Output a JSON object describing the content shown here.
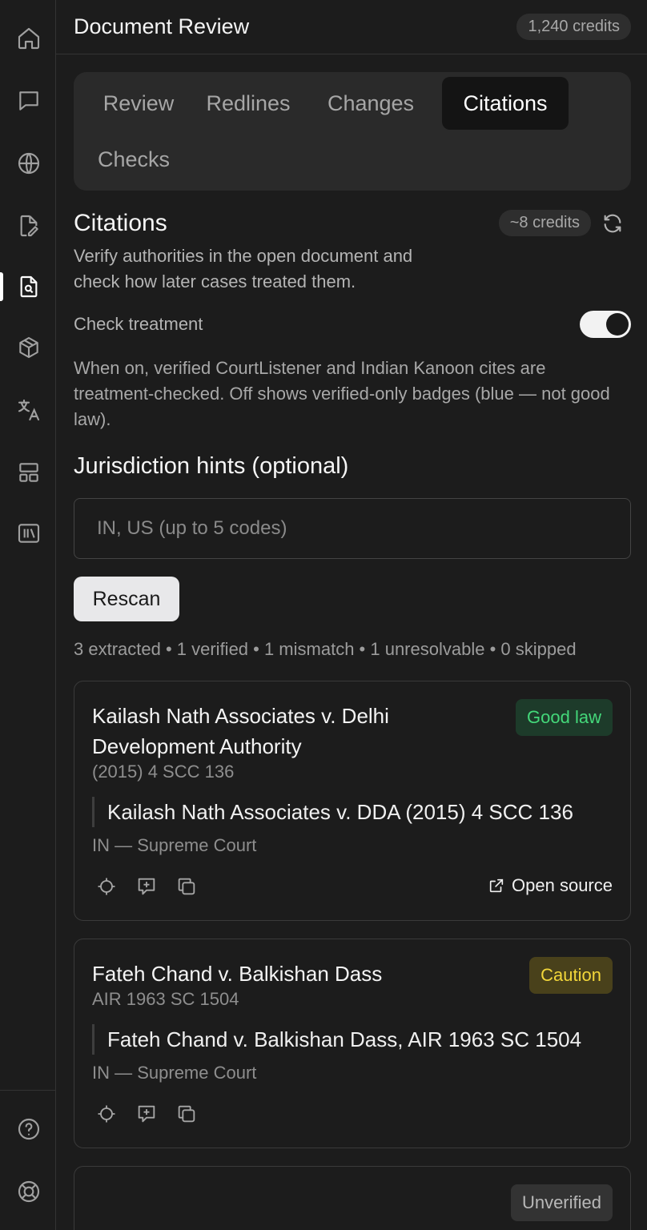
{
  "sidebar": {
    "icons": [
      {
        "name": "home-icon"
      },
      {
        "name": "chat-icon"
      },
      {
        "name": "globe-icon"
      },
      {
        "name": "file-edit-icon"
      },
      {
        "name": "document-search-icon",
        "active": true
      },
      {
        "name": "package-icon"
      },
      {
        "name": "translate-icon"
      },
      {
        "name": "layout-icon"
      },
      {
        "name": "library-icon"
      },
      {
        "name": "help-icon"
      },
      {
        "name": "lifebuoy-icon"
      }
    ]
  },
  "header": {
    "title": "Document Review",
    "credits": "1,240 credits"
  },
  "tabs": [
    {
      "label": "Review"
    },
    {
      "label": "Redlines"
    },
    {
      "label": "Changes"
    },
    {
      "label": "Citations",
      "active": true
    },
    {
      "label": "Checks"
    }
  ],
  "citations": {
    "title": "Citations",
    "description": "Verify authorities in the open document and check how later cases treated them.",
    "estimate": "~8 credits",
    "toggle_label": "Check treatment",
    "toggle_on": true,
    "help": "When on, verified CourtListener and Indian Kanoon cites are treatment-checked. Off shows verified-only badges (blue — not good law).",
    "jurisdiction_label": "Jurisdiction hints (optional)",
    "jurisdiction_placeholder": "IN, US (up to 5 codes)",
    "jurisdiction_value": "",
    "rescan_label": "Rescan",
    "summary": "3 extracted • 1 verified • 1 mismatch • 1 unresolvable • 0 skipped"
  },
  "cards": [
    {
      "title": "Kailash Nath Associates v. Delhi Development Authority",
      "citation": "(2015) 4 SCC 136",
      "quote": "Kailash Nath Associates v. DDA (2015) 4 SCC 136",
      "jurisdiction": "IN — Supreme Court",
      "badge": "Good law",
      "badge_color": "#44d87a",
      "open_source": "Open source"
    },
    {
      "title": "Fateh Chand v. Balkishan Dass",
      "citation": "AIR 1963 SC 1504",
      "quote": "Fateh Chand v. Balkishan Dass, AIR 1963 SC 1504",
      "jurisdiction": "IN — Supreme Court",
      "badge": "Caution",
      "badge_color": "#f2d63a"
    },
    {
      "badge": "Unverified",
      "badge_color": "#b8b8b8"
    }
  ],
  "colors": {
    "background": "#1c1c1c",
    "panel": "#2a2a2a",
    "good": "#44d87a",
    "caution": "#f2d63a"
  }
}
